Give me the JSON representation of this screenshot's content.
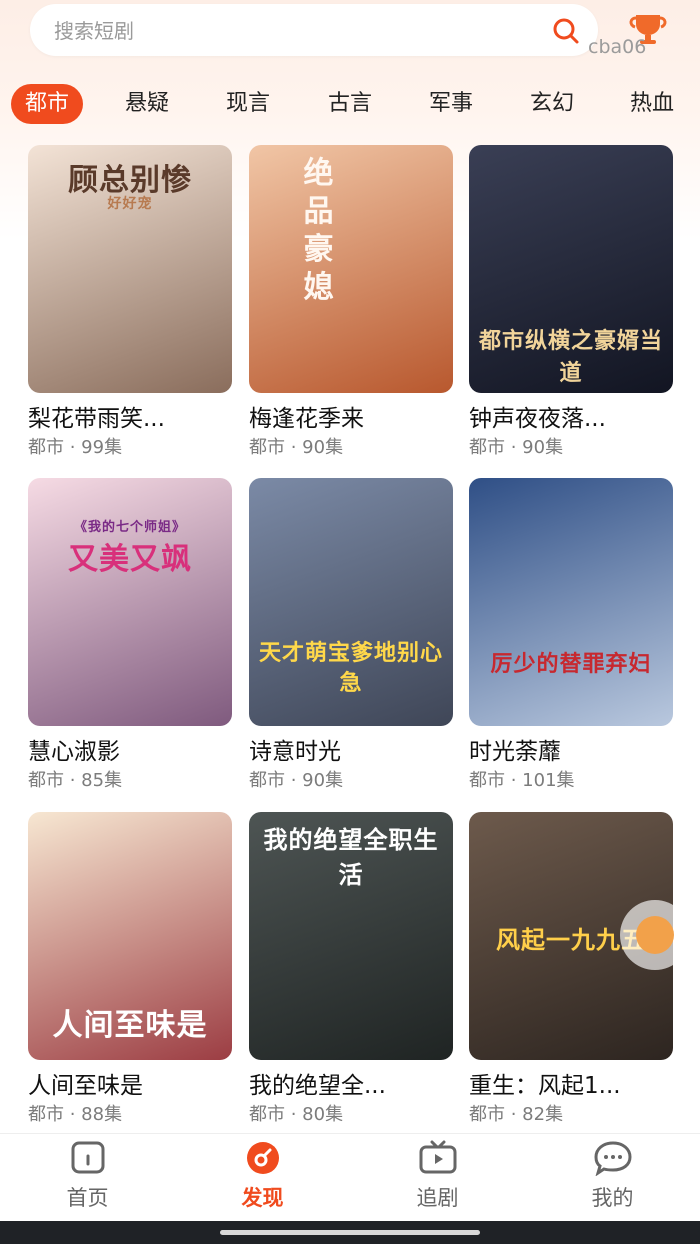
{
  "search": {
    "placeholder": "搜索短剧"
  },
  "user_tag": "cba06",
  "tabs": [
    {
      "label": "都市",
      "active": true
    },
    {
      "label": "悬疑",
      "active": false
    },
    {
      "label": "现言",
      "active": false
    },
    {
      "label": "古言",
      "active": false
    },
    {
      "label": "军事",
      "active": false
    },
    {
      "label": "玄幻",
      "active": false
    },
    {
      "label": "热血",
      "active": false
    }
  ],
  "dramas": [
    {
      "title": "梨花带雨笑...",
      "meta": "都市 · 99集",
      "poster_text": "顾总别惨",
      "poster_sub": "好好宠",
      "colors": [
        "#f3e3d6",
        "#8a6d5c"
      ]
    },
    {
      "title": "梅逢花季来",
      "meta": "都市 · 90集",
      "poster_text": "绝品豪媳",
      "poster_sub": "",
      "colors": [
        "#f1c6a6",
        "#b8582e"
      ]
    },
    {
      "title": "钟声夜夜落...",
      "meta": "都市 · 90集",
      "poster_text": "都市纵横之豪婿当道",
      "poster_sub": "",
      "colors": [
        "#3a3f55",
        "#121522"
      ]
    },
    {
      "title": "慧心淑影",
      "meta": "都市 · 85集",
      "poster_text": "又美又飒",
      "poster_sub": "《我的七个师姐》",
      "colors": [
        "#f6dbe4",
        "#7f5a7e"
      ]
    },
    {
      "title": "诗意时光",
      "meta": "都市 · 90集",
      "poster_text": "天才萌宝爹地别心急",
      "poster_sub": "",
      "colors": [
        "#7b8aa6",
        "#3f4657"
      ]
    },
    {
      "title": "时光荼蘼",
      "meta": "都市 · 101集",
      "poster_text": "厉少的替罪弃妇",
      "poster_sub": "",
      "colors": [
        "#2f4f86",
        "#b9c8de"
      ]
    },
    {
      "title": "人间至味是",
      "meta": "都市 · 88集",
      "poster_text": "人间至味是",
      "poster_sub": "",
      "colors": [
        "#f7e7d2",
        "#9c3d43"
      ]
    },
    {
      "title": "我的绝望全...",
      "meta": "都市 · 80集",
      "poster_text": "我的绝望全职生活",
      "poster_sub": "",
      "colors": [
        "#4e5554",
        "#1f2423"
      ]
    },
    {
      "title": "重生：风起1...",
      "meta": "都市 · 82集",
      "poster_text": "风起一九九五",
      "poster_sub": "",
      "colors": [
        "#6d5a4c",
        "#2d2520"
      ]
    }
  ],
  "nav": [
    {
      "label": "首页",
      "icon": "home-icon",
      "active": false
    },
    {
      "label": "发现",
      "icon": "discover-icon",
      "active": true
    },
    {
      "label": "追剧",
      "icon": "tv-icon",
      "active": false
    },
    {
      "label": "我的",
      "icon": "chat-icon",
      "active": false
    }
  ],
  "accent_color": "#f04b1e"
}
